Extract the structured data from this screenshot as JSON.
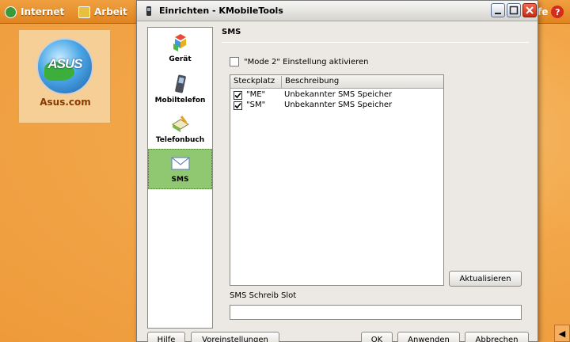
{
  "desktop": {
    "panel_internet": "Internet",
    "panel_arbeit": "Arbeit",
    "panel_right_text": "fe",
    "help_glyph": "?",
    "icon_label": "Asus.com",
    "icon_logo_text": "ASUS",
    "tray_arrow_glyph": "◀"
  },
  "window": {
    "title": "Einrichten - KMobileTools",
    "sidebar": [
      {
        "label": "Gerät",
        "icon": "device-icon"
      },
      {
        "label": "Mobiltelefon",
        "icon": "mobile-phone-icon"
      },
      {
        "label": "Telefonbuch",
        "icon": "phonebook-icon"
      },
      {
        "label": "SMS",
        "icon": "sms-icon",
        "active": true
      }
    ],
    "section_title": "SMS",
    "mode2_label": "\"Mode 2\" Einstellung aktivieren",
    "mode2_checked": false,
    "table": {
      "columns": [
        "Steckplatz",
        "Beschreibung"
      ],
      "rows": [
        {
          "slot": "\"ME\"",
          "desc": "Unbekannter SMS Speicher",
          "checked": true
        },
        {
          "slot": "\"SM\"",
          "desc": "Unbekannter SMS Speicher",
          "checked": true
        }
      ]
    },
    "refresh_button": "Aktualisieren",
    "write_slot_label": "SMS Schreib Slot",
    "write_slot_value": "",
    "footer": {
      "help": "Hilfe",
      "defaults": "Voreinstellungen",
      "ok": "OK",
      "apply": "Anwenden",
      "cancel": "Abbrechen"
    }
  },
  "colors": {
    "desktop": "#f2a648",
    "active_item": "#8fc870",
    "close_button": "#c52a14"
  }
}
